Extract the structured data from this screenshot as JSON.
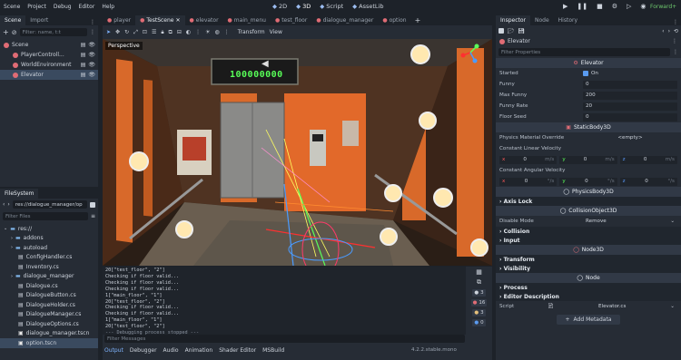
{
  "menu": [
    "Scene",
    "Project",
    "Debug",
    "Editor",
    "Help"
  ],
  "workspaces": [
    {
      "label": "2D",
      "icon": "2d-icon"
    },
    {
      "label": "3D",
      "icon": "3d-icon",
      "active": true
    },
    {
      "label": "Script",
      "icon": "script-icon"
    },
    {
      "label": "AssetLib",
      "icon": "assetlib-icon"
    }
  ],
  "renderer": "Forward+",
  "scene_dock": {
    "tabs": [
      "Scene",
      "Import"
    ],
    "filter_placeholder": "Filter: name, t:t",
    "nodes": [
      {
        "name": "Scene",
        "level": 0,
        "color": "#e06c75"
      },
      {
        "name": "PlayerControll...",
        "level": 1,
        "color": "#e06c75"
      },
      {
        "name": "WorldEnvironment",
        "level": 1,
        "color": "#e06c75"
      },
      {
        "name": "Elevator",
        "level": 1,
        "color": "#e06c75",
        "selected": true
      }
    ]
  },
  "filesystem": {
    "tab": "FileSystem",
    "path": "res://dialogue_manager/op",
    "filter_placeholder": "Filter Files",
    "items": [
      {
        "name": "res://",
        "level": 0,
        "type": "folder"
      },
      {
        "name": "addons",
        "level": 1,
        "type": "folder"
      },
      {
        "name": "autoload",
        "level": 1,
        "type": "folder"
      },
      {
        "name": "ConfigHandler.cs",
        "level": 2,
        "type": "file"
      },
      {
        "name": "Inventory.cs",
        "level": 2,
        "type": "file"
      },
      {
        "name": "dialogue_manager",
        "level": 1,
        "type": "folder"
      },
      {
        "name": "Dialogue.cs",
        "level": 2,
        "type": "file"
      },
      {
        "name": "DialogueButton.cs",
        "level": 2,
        "type": "file"
      },
      {
        "name": "DialogueHolder.cs",
        "level": 2,
        "type": "file"
      },
      {
        "name": "DialogueManager.cs",
        "level": 2,
        "type": "file"
      },
      {
        "name": "DialogueOptions.cs",
        "level": 2,
        "type": "file"
      },
      {
        "name": "dialogue_manager.tscn",
        "level": 2,
        "type": "scene"
      },
      {
        "name": "option.tscn",
        "level": 2,
        "type": "scene",
        "selected": true
      }
    ]
  },
  "scene_tabs": [
    "player",
    "TestScene",
    "elevator",
    "main_menu",
    "test_floor",
    "dialogue_manager",
    "option"
  ],
  "active_scene_tab": "TestScene",
  "viewport": {
    "toolbar_items": [
      "Transform",
      "View"
    ],
    "perspective_label": "Perspective",
    "counter_display": "100000000"
  },
  "output": {
    "lines": [
      "20[\"test_floor\", \"2\"]",
      "Checking if floor valid...",
      "Checking if floor valid...",
      "Checking if floor valid...",
      "1[\"main_floor\", \"1\"]",
      "20[\"test_floor\", \"2\"]",
      "Checking if floor valid...",
      "Checking if floor valid...",
      "1[\"main_floor\", \"1\"]",
      "20[\"test_floor\", \"2\"]",
      "--- Debugging process stopped ---"
    ],
    "filter_placeholder": "Filter Messages",
    "bottom_tabs": [
      "Output",
      "Debugger",
      "Audio",
      "Animation",
      "Shader Editor",
      "MSBuild"
    ],
    "version": "4.2.2.stable.mono",
    "counts": [
      "3",
      "16",
      "3",
      "0"
    ]
  },
  "inspector": {
    "tabs": [
      "Inspector",
      "Node",
      "History"
    ],
    "object": "Elevator",
    "filter_placeholder": "Filter Properties",
    "sections": [
      {
        "title": "Elevator",
        "rows": [
          {
            "label": "Started",
            "value": "On",
            "type": "check"
          },
          {
            "label": "Funny",
            "value": "0"
          },
          {
            "label": "Max Funny",
            "value": "200"
          },
          {
            "label": "Funny Rate",
            "value": "20"
          },
          {
            "label": "Floor Seed",
            "value": "0"
          }
        ]
      },
      {
        "title": "StaticBody3D",
        "rows": [
          {
            "label": "Physics Material Override",
            "value": "<empty>"
          }
        ]
      }
    ],
    "constant_linear_velocity": {
      "label": "Constant Linear Velocity",
      "x": "0",
      "y": "0",
      "z": "0",
      "unit": "m/s"
    },
    "constant_angular_velocity": {
      "label": "Constant Angular Velocity",
      "x": "0",
      "y": "0",
      "z": "0",
      "unit": "°/s"
    },
    "physicsbody": "PhysicsBody3D",
    "axis_lock": "Axis Lock",
    "collisionobject": "CollisionObject3D",
    "disable_mode": {
      "label": "Disable Mode",
      "value": "Remove"
    },
    "collision": "Collision",
    "input": "Input",
    "node3d": "Node3D",
    "transform": "Transform",
    "visibility": "Visibility",
    "node": "Node",
    "process": "Process",
    "editor_description": "Editor Description",
    "script": {
      "label": "Script",
      "value": "Elevator.cs"
    },
    "add_metadata": "Add Metadata"
  }
}
